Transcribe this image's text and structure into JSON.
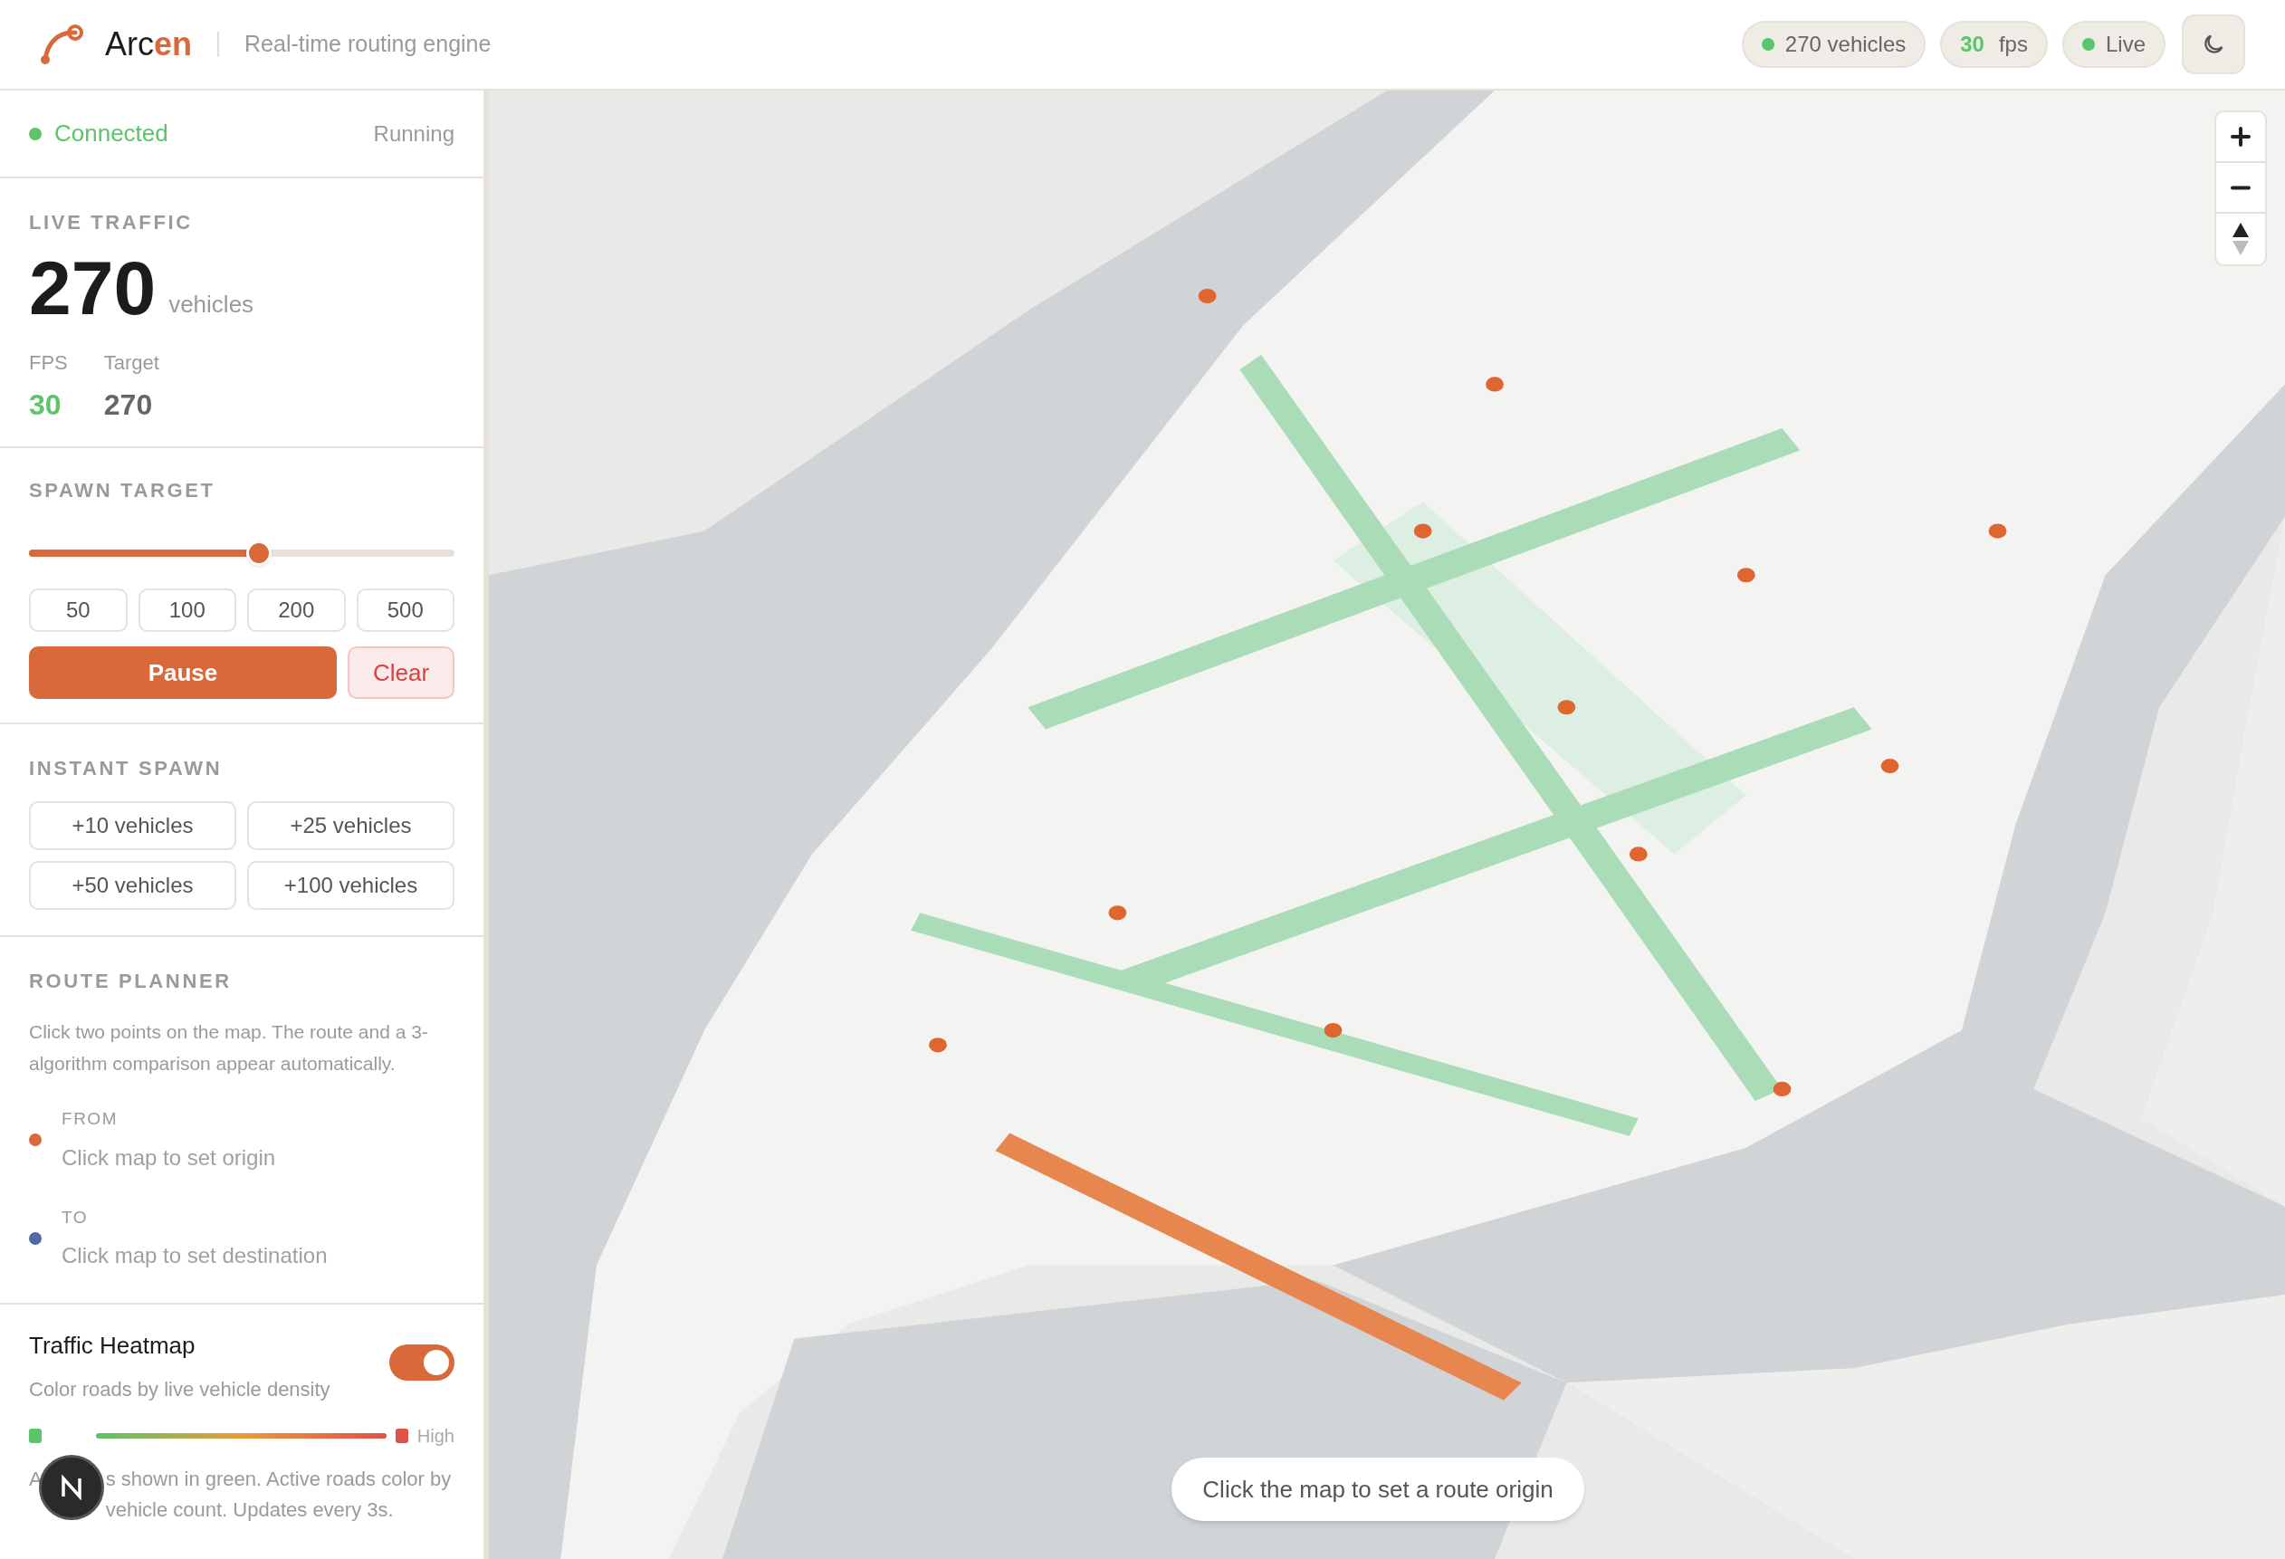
{
  "header": {
    "brand_prefix": "Arc",
    "brand_accent": "en",
    "tagline": "Real-time routing engine",
    "badges": [
      {
        "kind": "dot",
        "text": "270 vehicles"
      },
      {
        "kind": "metric",
        "value": "30",
        "unit": "fps"
      },
      {
        "kind": "dot",
        "text": "Live"
      }
    ]
  },
  "status": {
    "label": "Connected",
    "state": "Running"
  },
  "live_traffic": {
    "title": "LIVE TRAFFIC",
    "count": "270",
    "unit": "vehicles",
    "stats": [
      {
        "label": "FPS",
        "value": "30",
        "kind": "good"
      },
      {
        "label": "Target",
        "value": "270",
        "kind": "plain"
      }
    ]
  },
  "spawn_target": {
    "title": "SPAWN TARGET",
    "level": 0.54,
    "presets": [
      "50",
      "100",
      "200",
      "500"
    ],
    "pause": "Pause",
    "clear": "Clear"
  },
  "instant_spawn": {
    "title": "INSTANT SPAWN",
    "buttons": [
      "+10 vehicles",
      "+25 vehicles",
      "+50 vehicles",
      "+100 vehicles"
    ]
  },
  "route_planner": {
    "title": "ROUTE PLANNER",
    "description": "Click two points on the map. The route and a 3-algorithm comparison appear automatically.",
    "points": [
      {
        "label": "FROM",
        "hint": "Click map to set origin",
        "color": "#d9683a"
      },
      {
        "label": "TO",
        "hint": "Click map to set destination",
        "color": "#4f6aa6"
      }
    ]
  },
  "heatmap": {
    "title": "Traffic Heatmap",
    "subtitle": "Color roads by live vehicle density",
    "on": true,
    "high_label": "High",
    "note_start": "A",
    "note": "s shown in green. Active roads color by vehicle count. Updates every 3s."
  },
  "map": {
    "hint": "Click the map to set a route origin"
  }
}
